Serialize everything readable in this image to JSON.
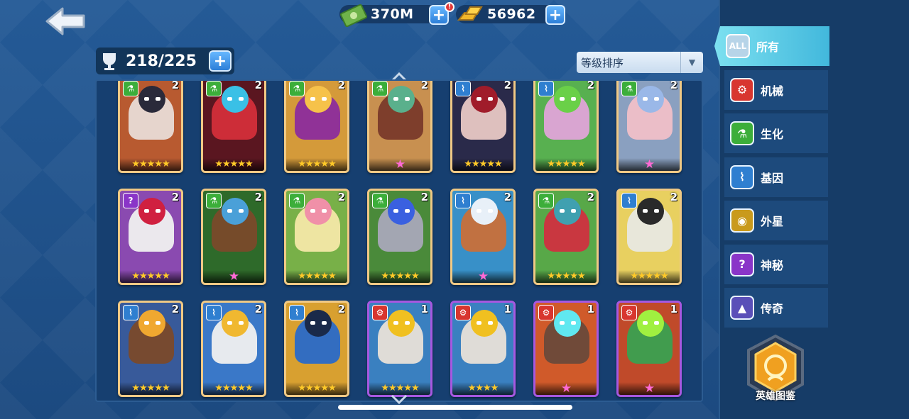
{
  "currencies": [
    {
      "name": "cash",
      "icon": "cash-bundle-icon",
      "value": "370M",
      "badge": "!"
    },
    {
      "name": "gold",
      "icon": "gold-bars-icon",
      "value": "56962"
    }
  ],
  "capacity": {
    "icon": "trophy-cup-icon",
    "value": "218/225"
  },
  "sort": {
    "label": "等级排序"
  },
  "tabs": [
    {
      "id": "all",
      "icon_text": "ALL",
      "label": "所有",
      "color": "#b7d4e8",
      "active": true
    },
    {
      "id": "mech",
      "icon_text": "⚙",
      "label": "机械",
      "color": "#d8362f"
    },
    {
      "id": "bio",
      "icon_text": "⚗",
      "label": "生化",
      "color": "#3cae3a"
    },
    {
      "id": "gene",
      "icon_text": "⌇",
      "label": "基因",
      "color": "#2f7fd0"
    },
    {
      "id": "alien",
      "icon_text": "◉",
      "label": "外星",
      "color": "#c99a1c"
    },
    {
      "id": "mystic",
      "icon_text": "?",
      "label": "神秘",
      "color": "#8a35c8"
    },
    {
      "id": "legend",
      "icon_text": "▲",
      "label": "传奇",
      "color": "#5a4fb8"
    }
  ],
  "codex": {
    "label": "英雄图鉴"
  },
  "heroes": [
    {
      "faction": "bio",
      "level": "2",
      "stars": "★★★★★",
      "star_type": "gold",
      "bg": "#b85a30",
      "body": "#e8dcd6",
      "accent": "#2a2a3a"
    },
    {
      "faction": "bio",
      "level": "2",
      "stars": "★★★★★",
      "star_type": "gold",
      "bg": "#5a1620",
      "body": "#d42e3a",
      "accent": "#3ac0e6"
    },
    {
      "faction": "bio",
      "level": "2",
      "stars": "★★★★★",
      "star_type": "gold",
      "bg": "#d49a3a",
      "body": "#8c2c9c",
      "accent": "#f6c24a"
    },
    {
      "faction": "bio",
      "level": "2",
      "stars": "★",
      "star_type": "pink",
      "bg": "#c89050",
      "body": "#7a3a2a",
      "accent": "#5ab08c"
    },
    {
      "faction": "gene",
      "level": "2",
      "stars": "★★★★★",
      "star_type": "gold",
      "bg": "#2a2a4a",
      "body": "#e8c8c4",
      "accent": "#a01c2a"
    },
    {
      "faction": "gene",
      "level": "2",
      "stars": "★★★★★",
      "star_type": "gold",
      "bg": "#58b050",
      "body": "#e0a4d8",
      "accent": "#6ad048"
    },
    {
      "faction": "bio",
      "level": "2",
      "stars": "★",
      "star_type": "pink",
      "bg": "#8aa0c0",
      "body": "#f0c0c8",
      "accent": "#9ab8e8"
    },
    {
      "faction": "mystic",
      "level": "2",
      "stars": "★★★★★",
      "star_type": "gold",
      "bg": "#8a4ab0",
      "body": "#f0f0f0",
      "accent": "#d02040"
    },
    {
      "faction": "bio",
      "level": "2",
      "stars": "★",
      "star_type": "pink",
      "bg": "#2e6a2a",
      "body": "#7a4a2a",
      "accent": "#4aa0d8"
    },
    {
      "faction": "bio",
      "level": "2",
      "stars": "★★★★★",
      "star_type": "gold",
      "bg": "#78b048",
      "body": "#f4e8a8",
      "accent": "#f090a8"
    },
    {
      "faction": "bio",
      "level": "2",
      "stars": "★★★★★",
      "star_type": "gold",
      "bg": "#4a8a3a",
      "body": "#a8a8b8",
      "accent": "#3a60e0"
    },
    {
      "faction": "gene",
      "level": "2",
      "stars": "★",
      "star_type": "pink",
      "bg": "#3890c8",
      "body": "#c8703a",
      "accent": "#e8f0f8"
    },
    {
      "faction": "bio",
      "level": "2",
      "stars": "★★★★★",
      "star_type": "gold",
      "bg": "#58a848",
      "body": "#d03040",
      "accent": "#40a0b0"
    },
    {
      "faction": "gene",
      "level": "2",
      "stars": "★★★★★",
      "star_type": "gold",
      "bg": "#e8d060",
      "body": "#e8e8e0",
      "accent": "#2a2a2a"
    },
    {
      "faction": "gene",
      "level": "2",
      "stars": "★★★★★",
      "star_type": "gold",
      "bg": "#385a9a",
      "body": "#7a4a2a",
      "accent": "#f0a830"
    },
    {
      "faction": "gene",
      "level": "2",
      "stars": "★★★★★",
      "star_type": "gold",
      "bg": "#3a78c8",
      "body": "#f0f0f0",
      "accent": "#f0b830"
    },
    {
      "faction": "gene",
      "level": "2",
      "stars": "★★★★★",
      "star_type": "gold",
      "bg": "#d8a030",
      "body": "#2a6ac8",
      "accent": "#1a2a4a"
    },
    {
      "faction": "mech",
      "level": "1",
      "stars": "★★★★★",
      "star_type": "gold",
      "bg": "#3a80c0",
      "body": "#e8e0d8",
      "accent": "#f0c020",
      "epic": true
    },
    {
      "faction": "mech",
      "level": "1",
      "stars": "★★★★",
      "star_type": "gold",
      "bg": "#3a80c0",
      "body": "#e8e0d8",
      "accent": "#f0c020",
      "epic": true
    },
    {
      "faction": "mech",
      "level": "1",
      "stars": "★",
      "star_type": "pink",
      "bg": "#d05a2a",
      "body": "#6a4a3a",
      "accent": "#60e8f0",
      "epic": true
    },
    {
      "faction": "mech",
      "level": "1",
      "stars": "★",
      "star_type": "pink",
      "bg": "#c04a2a",
      "body": "#3aa050",
      "accent": "#a0f040",
      "epic": true
    }
  ],
  "colors": {
    "mech": "#d8362f",
    "bio": "#3cae3a",
    "gene": "#2f7fd0",
    "mystic": "#8a35c8"
  }
}
